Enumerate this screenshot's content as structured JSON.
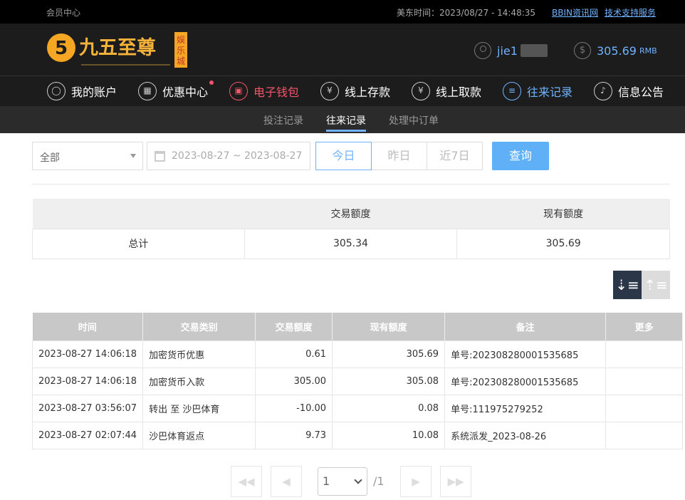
{
  "topbar": {
    "member_center": "会员中心",
    "time_label": "美东时间：2023/08/27 - 14:48:35",
    "link_news": "BBIN资讯网",
    "link_support": "技术支持服务"
  },
  "header": {
    "logo_text": "九五至尊",
    "logo_tag": "娱乐城",
    "username": "jie1",
    "balance": "305.69",
    "currency": "RMB"
  },
  "nav": {
    "items": [
      {
        "label": "我的账户",
        "icon": "user-icon"
      },
      {
        "label": "优惠中心",
        "icon": "gift-icon"
      },
      {
        "label": "电子钱包",
        "icon": "wallet-icon"
      },
      {
        "label": "线上存款",
        "icon": "deposit-icon"
      },
      {
        "label": "线上取款",
        "icon": "withdraw-icon"
      },
      {
        "label": "往来记录",
        "icon": "records-icon"
      },
      {
        "label": "信息公告",
        "icon": "bell-icon"
      }
    ]
  },
  "subnav": {
    "bets": "投注记录",
    "records": "往来记录",
    "pending": "处理中订单"
  },
  "filter": {
    "type_selected": "全部",
    "date_range": "2023-08-27 ~ 2023-08-27",
    "today": "今日",
    "yesterday": "昨日",
    "last7": "近7日",
    "query": "查询"
  },
  "summary": {
    "col_amount": "交易额度",
    "col_balance": "现有额度",
    "total_label": "总计",
    "total_amount": "305.34",
    "total_balance": "305.69"
  },
  "records": {
    "headers": [
      "时间",
      "交易类别",
      "交易额度",
      "现有额度",
      "备注",
      "更多"
    ],
    "rows": [
      [
        "2023-08-27 14:06:18",
        "加密货币优惠",
        "0.61",
        "305.69",
        "单号:202308280001535685",
        ""
      ],
      [
        "2023-08-27 14:06:18",
        "加密货币入款",
        "305.00",
        "305.08",
        "单号:202308280001535685",
        ""
      ],
      [
        "2023-08-27 03:56:07",
        "转出 至 沙巴体育",
        "-10.00",
        "0.08",
        "单号:111975279252",
        ""
      ],
      [
        "2023-08-27 02:07:44",
        "沙巴体育返点",
        "9.73",
        "10.08",
        "系统派发_2023-08-26",
        ""
      ]
    ]
  },
  "pager": {
    "current": "1",
    "total": "/1"
  }
}
